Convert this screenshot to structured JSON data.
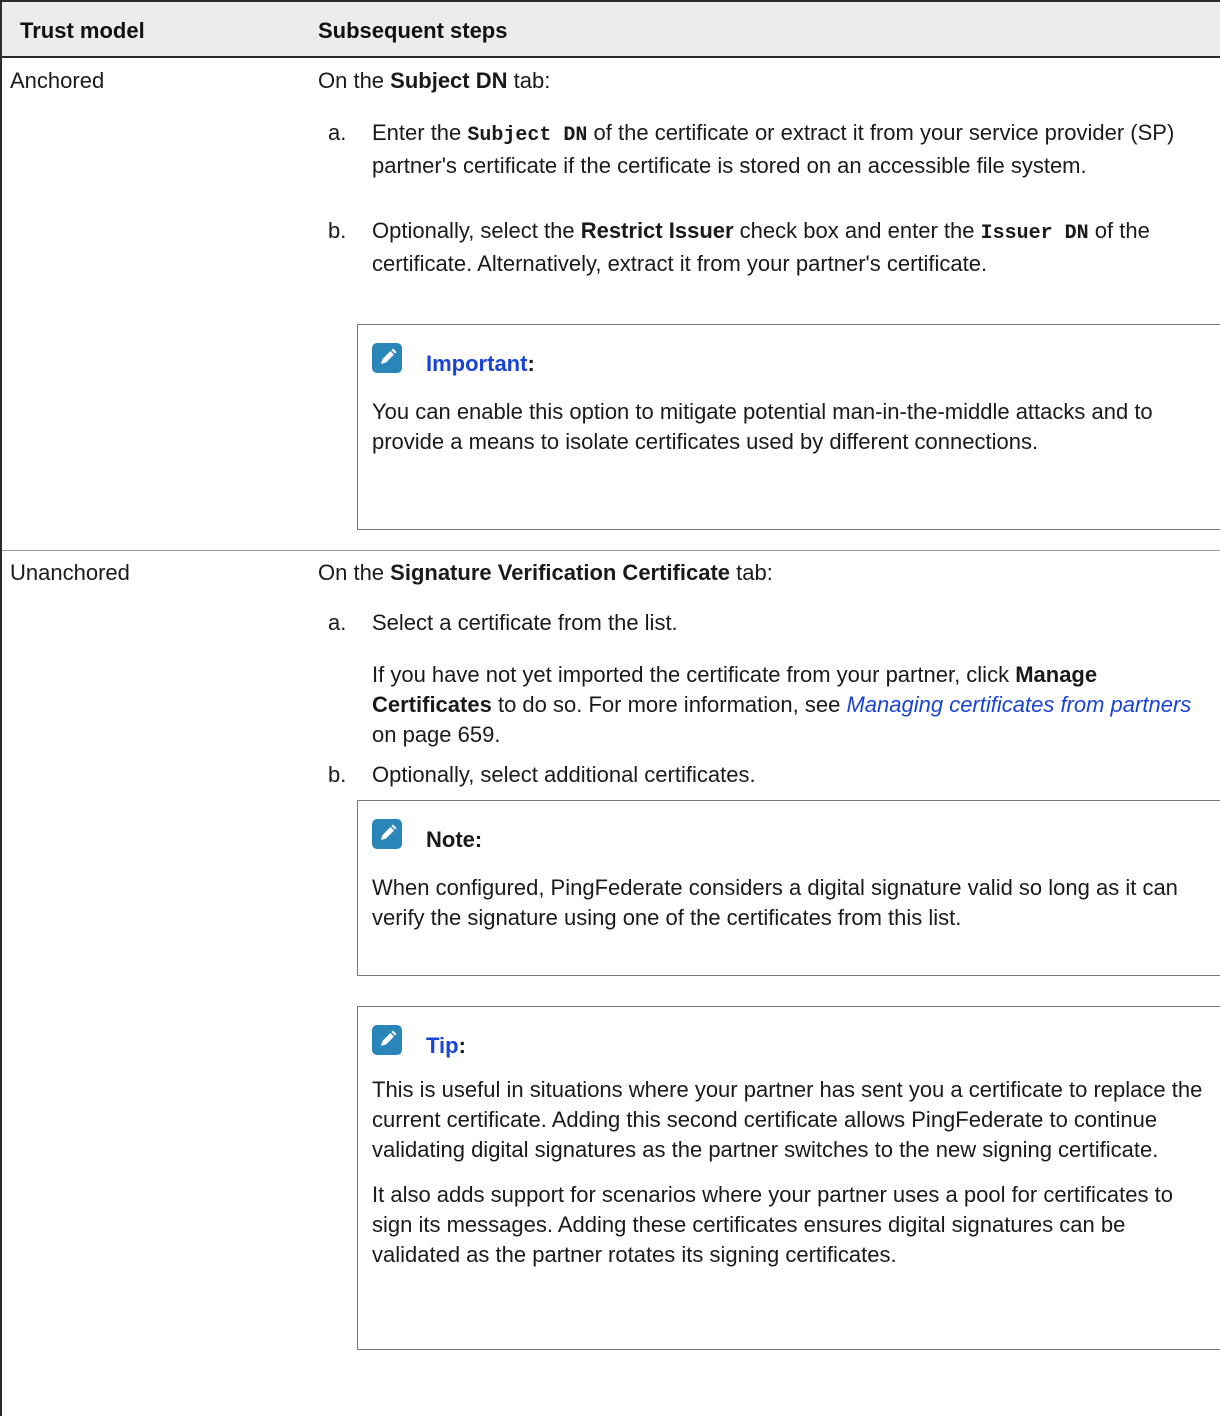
{
  "table": {
    "headers": [
      "Trust model",
      "Subsequent steps"
    ],
    "rows": [
      {
        "model": "Anchored",
        "intro": {
          "pre": "On the ",
          "bold": "Subject DN",
          "post": " tab:"
        },
        "steps": [
          {
            "label": "a.",
            "p1": "Enter the ",
            "code1": "Subject DN",
            "p2": " of the certificate or extract it from your service provider (SP) partner's certificate if the certificate is stored on an accessible file system."
          },
          {
            "label": "b.",
            "p1": "Optionally, select the ",
            "bold1": "Restrict Issuer",
            "p2": " check box and enter the ",
            "code1": "Issuer DN",
            "p3": " of the certificate. Alternatively, extract it from your partner's certificate."
          }
        ],
        "callout": {
          "icon": "pencil-note-icon",
          "title": "Important",
          "colon": ":",
          "body": "You can enable this option to mitigate potential man-in-the-middle attacks and to provide a means to isolate certificates used by different connections."
        }
      },
      {
        "model": "Unanchored",
        "intro": {
          "pre": "On the ",
          "bold": "Signature Verification Certificate",
          "post": " tab:"
        },
        "steps": [
          {
            "label": "a.",
            "text": "Select a certificate from the list.",
            "extra_pre": "If you have not yet imported the certificate from your partner, click ",
            "extra_bold": "Manage Certificates",
            "extra_mid": " to do so. For more information, see ",
            "extra_link": "Managing certificates from partners",
            "extra_post": " on page 659."
          },
          {
            "label": "b.",
            "text": "Optionally, select additional certificates."
          }
        ],
        "callouts": [
          {
            "icon": "pencil-note-icon",
            "title": "Note:",
            "body": "When configured, PingFederate considers a digital signature valid so long as it can verify the signature using one of the certificates from this list."
          },
          {
            "icon": "pencil-note-icon",
            "title": "Tip",
            "colon": ":",
            "body1": "This is useful in situations where your partner has sent you a certificate to replace the current certificate. Adding this second certificate allows PingFederate to continue validating digital signatures as the partner switches to the new signing certificate.",
            "body2": "It also adds support for scenarios where your partner uses a pool for certificates to sign its messages. Adding these certificates ensures digital signatures can be validated as the partner rotates its signing certificates."
          }
        ]
      }
    ]
  },
  "colors": {
    "link": "#1a44d6",
    "icon": "#2a86b8",
    "header_bg": "#ececec"
  }
}
